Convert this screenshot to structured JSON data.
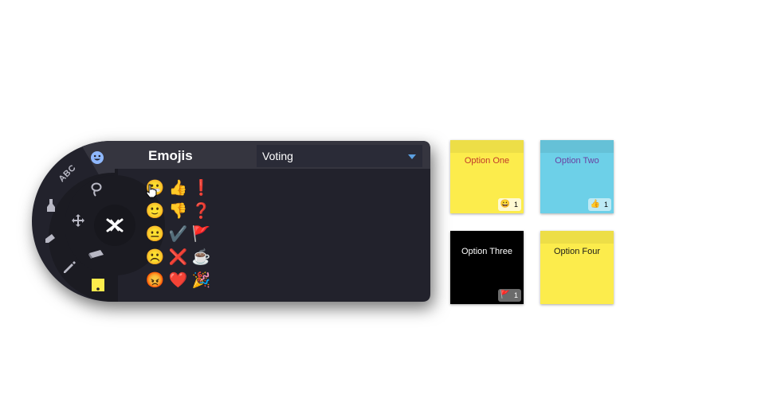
{
  "panel": {
    "title": "Emojis",
    "dropdown": {
      "selected": "Voting"
    },
    "emojis": [
      "😬",
      "👍",
      "❗",
      "🙂",
      "👎",
      "❓",
      "😐",
      "✔️",
      "🚩",
      "☹️",
      "❌",
      "☕",
      "😡",
      "❤️",
      "🎉"
    ]
  },
  "tools": {
    "text_label": "ABC"
  },
  "notes": [
    {
      "label": "Option One",
      "vote_emoji": "😀",
      "vote_count": "1",
      "color": "#fcec4c",
      "text_color": "#c0392b"
    },
    {
      "label": "Option Two",
      "vote_emoji": "👍",
      "vote_count": "1",
      "color": "#6dd0e8",
      "text_color": "#6a3fa0"
    },
    {
      "label": "Option Three",
      "vote_emoji": "🚩",
      "vote_count": "1",
      "color": "#000000",
      "text_color": "#ffffff"
    },
    {
      "label": "Option Four",
      "color": "#fcec4c",
      "text_color": "#1a1a1a"
    }
  ],
  "colors": {
    "panel_bg": "#22222c",
    "header_bg": "#35353f",
    "accent": "#5b9fe0"
  }
}
